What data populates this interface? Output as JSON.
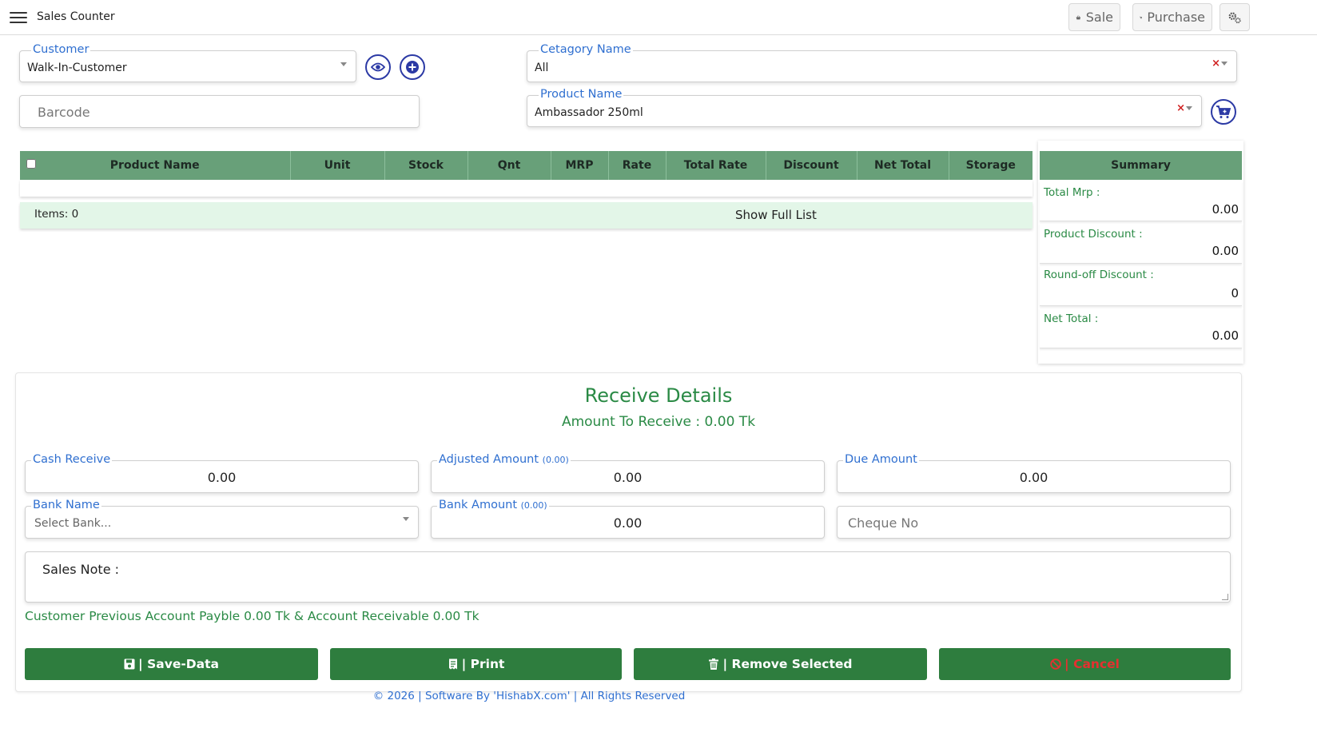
{
  "header": {
    "title": "Sales Counter",
    "sale_label": "Sale",
    "purchase_label": "Purchase"
  },
  "form": {
    "customer": {
      "label": "Customer",
      "value": "Walk-In-Customer"
    },
    "barcode": {
      "placeholder": "Barcode"
    },
    "category": {
      "label": "Cetagory Name",
      "value": "All"
    },
    "product": {
      "label": "Product Name",
      "value": "Ambassador 250ml"
    }
  },
  "table": {
    "columns": [
      "Product Name",
      "Unit",
      "Stock",
      "Qnt",
      "MRP",
      "Rate",
      "Total Rate",
      "Discount",
      "Net Total",
      "Storage"
    ],
    "items_label": "Items: 0",
    "show_full_label": "Show Full List"
  },
  "summary": {
    "title": "Summary",
    "rows": [
      {
        "label": "Total Mrp :",
        "value": "0.00"
      },
      {
        "label": "Product Discount :",
        "value": "0.00"
      },
      {
        "label": "Round-off Discount :",
        "value": "0"
      },
      {
        "label": "Net Total :",
        "value": "0.00"
      }
    ]
  },
  "receive": {
    "title": "Receive Details",
    "amount_to_receive": "Amount To Receive : 0.00 Tk",
    "cash_receive": {
      "label": "Cash Receive",
      "value": "0.00"
    },
    "adjusted_amount": {
      "label": "Adjusted Amount",
      "hint": "(0.00)",
      "value": "0.00"
    },
    "due_amount": {
      "label": "Due Amount",
      "value": "0.00"
    },
    "bank_name": {
      "label": "Bank Name",
      "placeholder": "Select Bank..."
    },
    "bank_amount": {
      "label": "Bank Amount",
      "hint": "(0.00)",
      "value": "0.00"
    },
    "cheque_no": {
      "placeholder": "Cheque No"
    },
    "sales_note": {
      "placeholder": "Sales Note :"
    },
    "previous_account": "Customer Previous Account Payble 0.00 Tk & Account Receivable 0.00 Tk"
  },
  "actions": {
    "save": "| Save-Data",
    "print": "| Print",
    "remove": "| Remove Selected",
    "cancel": "| Cancel"
  },
  "footer": "© 2026 | Software By 'HishabX.com' | All Rights Reserved",
  "colors": {
    "table_header": "#68a079",
    "accent_green": "#2a8a45",
    "button_green": "#2e7d3e",
    "label_blue": "#2f6fd0",
    "cancel_red": "#e53030"
  }
}
